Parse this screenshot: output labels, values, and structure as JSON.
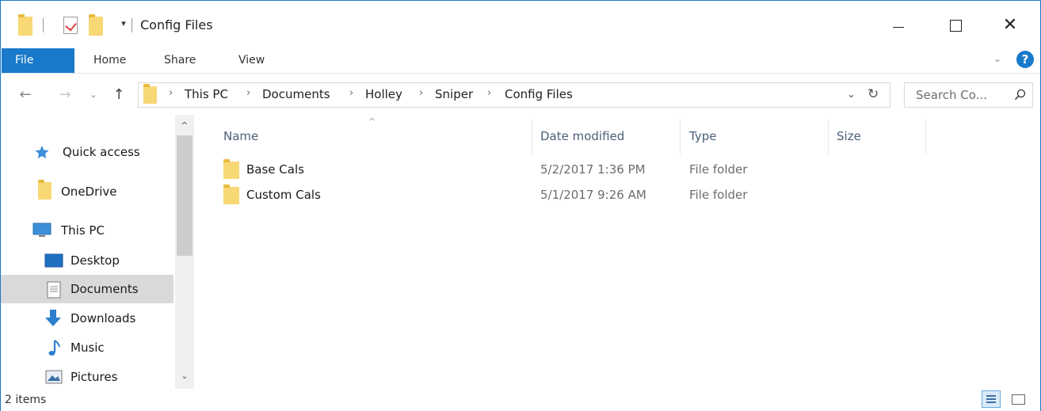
{
  "window": {
    "title": "Config Files"
  },
  "ribbon": {
    "tabs": [
      {
        "label": "File"
      },
      {
        "label": "Home"
      },
      {
        "label": "Share"
      },
      {
        "label": "View"
      }
    ],
    "help_label": "?"
  },
  "address": {
    "breadcrumb": [
      "This PC",
      "Documents",
      "Holley",
      "Sniper",
      "Config Files"
    ]
  },
  "search": {
    "placeholder": "Search Co..."
  },
  "sidebar": {
    "items": [
      {
        "label": "Quick access",
        "icon": "star-icon"
      },
      {
        "label": "OneDrive",
        "icon": "folder-icon"
      },
      {
        "label": "This PC",
        "icon": "computer-icon"
      },
      {
        "label": "Desktop",
        "icon": "desktop-icon"
      },
      {
        "label": "Documents",
        "icon": "documents-icon",
        "selected": true
      },
      {
        "label": "Downloads",
        "icon": "download-arrow-icon"
      },
      {
        "label": "Music",
        "icon": "music-note-icon"
      },
      {
        "label": "Pictures",
        "icon": "pictures-icon"
      }
    ]
  },
  "columns": [
    {
      "label": "Name"
    },
    {
      "label": "Date modified"
    },
    {
      "label": "Type"
    },
    {
      "label": "Size"
    }
  ],
  "files": [
    {
      "name": "Base Cals",
      "date_modified": "5/2/2017 1:36 PM",
      "type": "File folder"
    },
    {
      "name": "Custom Cals",
      "date_modified": "5/1/2017 9:26 AM",
      "type": "File folder"
    }
  ],
  "status": {
    "item_count": "2 items"
  },
  "colors": {
    "accent": "#1979ca",
    "folder": "#f8d775",
    "selected_bg": "#d9d9d9"
  }
}
